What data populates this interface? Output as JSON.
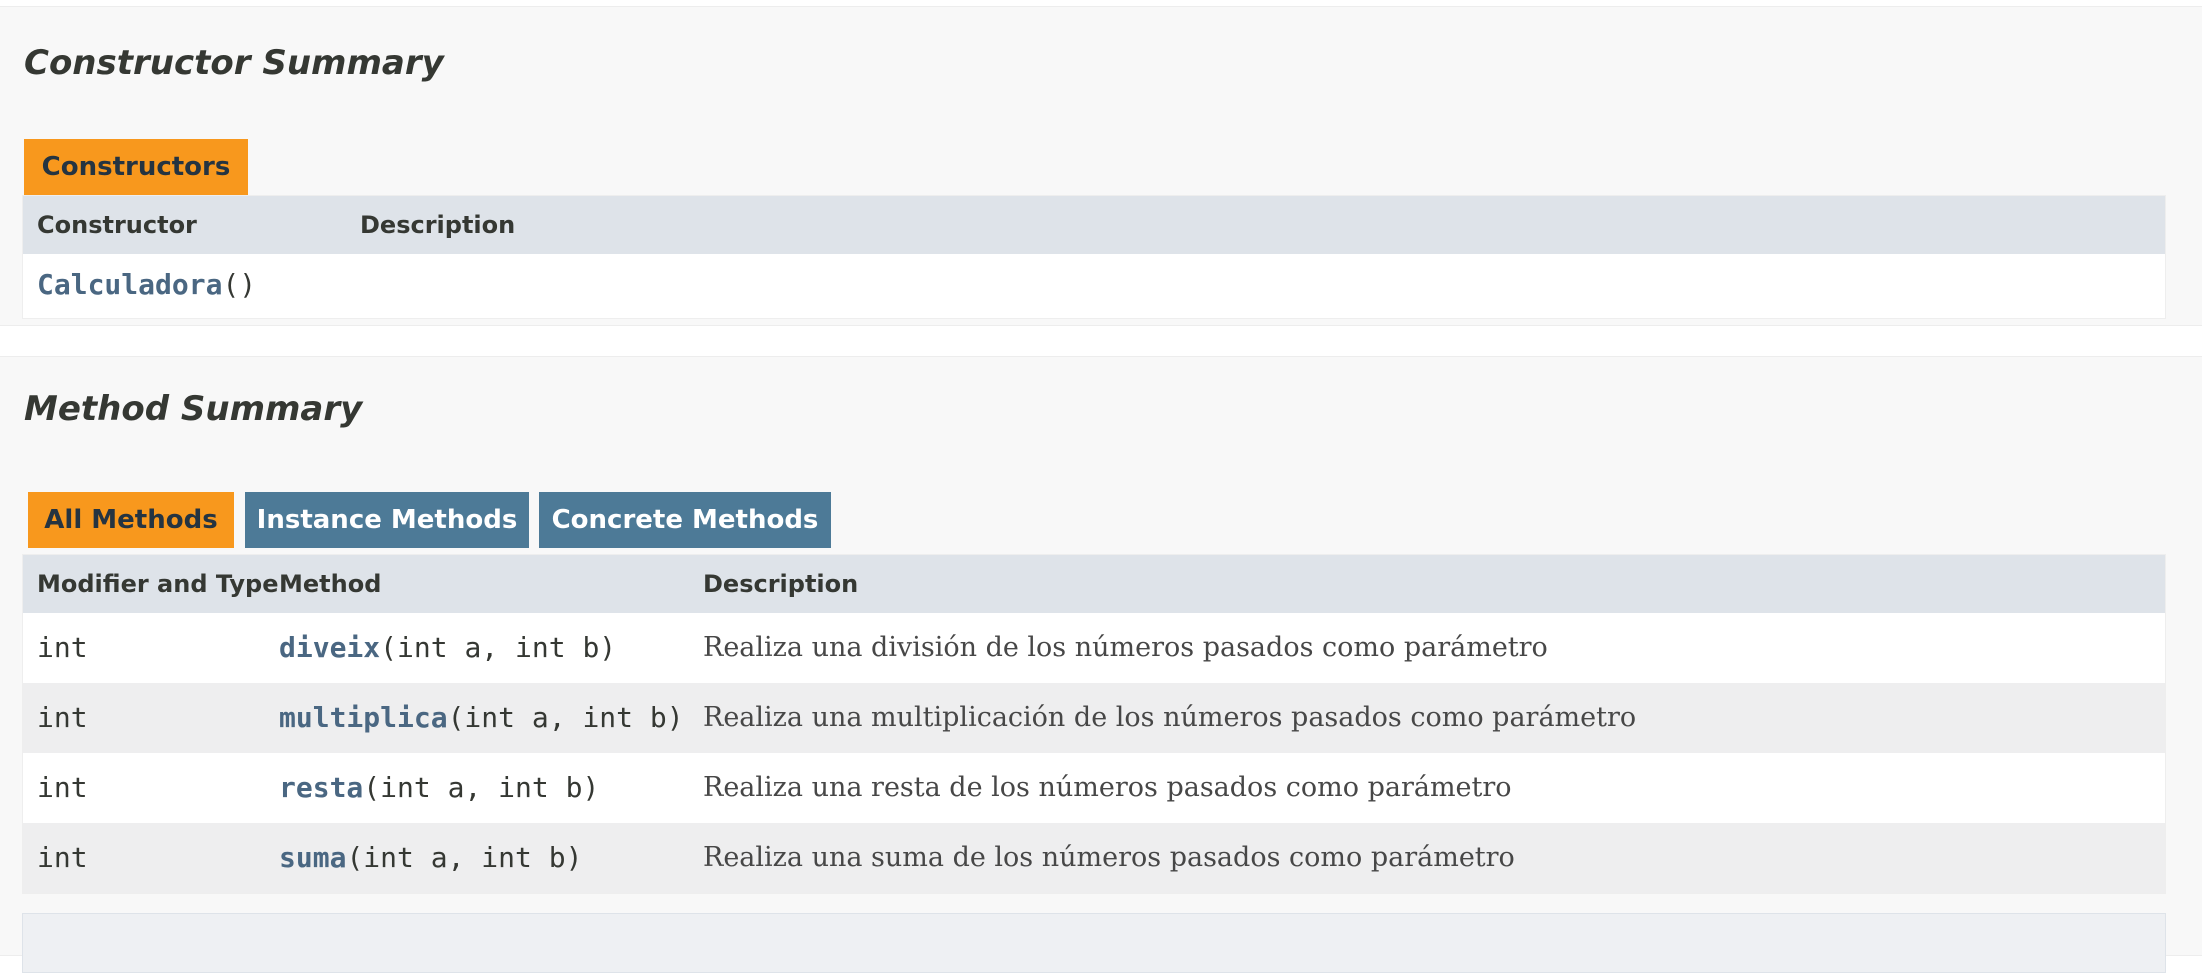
{
  "constructor_summary": {
    "title": "Constructor Summary",
    "tab_label": "Constructors",
    "headers": {
      "constructor": "Constructor",
      "description": "Description"
    },
    "rows": [
      {
        "name": "Calculadora",
        "params": "()"
      }
    ]
  },
  "method_summary": {
    "title": "Method Summary",
    "tabs": [
      {
        "label": "All Methods",
        "active": true
      },
      {
        "label": "Instance Methods",
        "active": false
      },
      {
        "label": "Concrete Methods",
        "active": false
      }
    ],
    "headers": {
      "modifier": "Modifier and Type",
      "method": "Method",
      "description": "Description"
    },
    "rows": [
      {
        "type": "int",
        "name": "diveix",
        "params": "(int a, int b)",
        "description": "Realiza una división de los números pasados como parámetro"
      },
      {
        "type": "int",
        "name": "multiplica",
        "params": "(int a, int b)",
        "description": "Realiza una multiplicación de los números pasados como parámetro"
      },
      {
        "type": "int",
        "name": "resta",
        "params": "(int a, int b)",
        "description": "Realiza una resta de los números pasados como parámetro"
      },
      {
        "type": "int",
        "name": "suma",
        "params": "(int a, int b)",
        "description": "Realiza una suma de los números pasados como parámetro"
      }
    ]
  },
  "colors": {
    "active_tab": "#f8981d",
    "inactive_tab": "#4d7a97",
    "header_bg": "#dee3e9",
    "link": "#4a6782"
  }
}
